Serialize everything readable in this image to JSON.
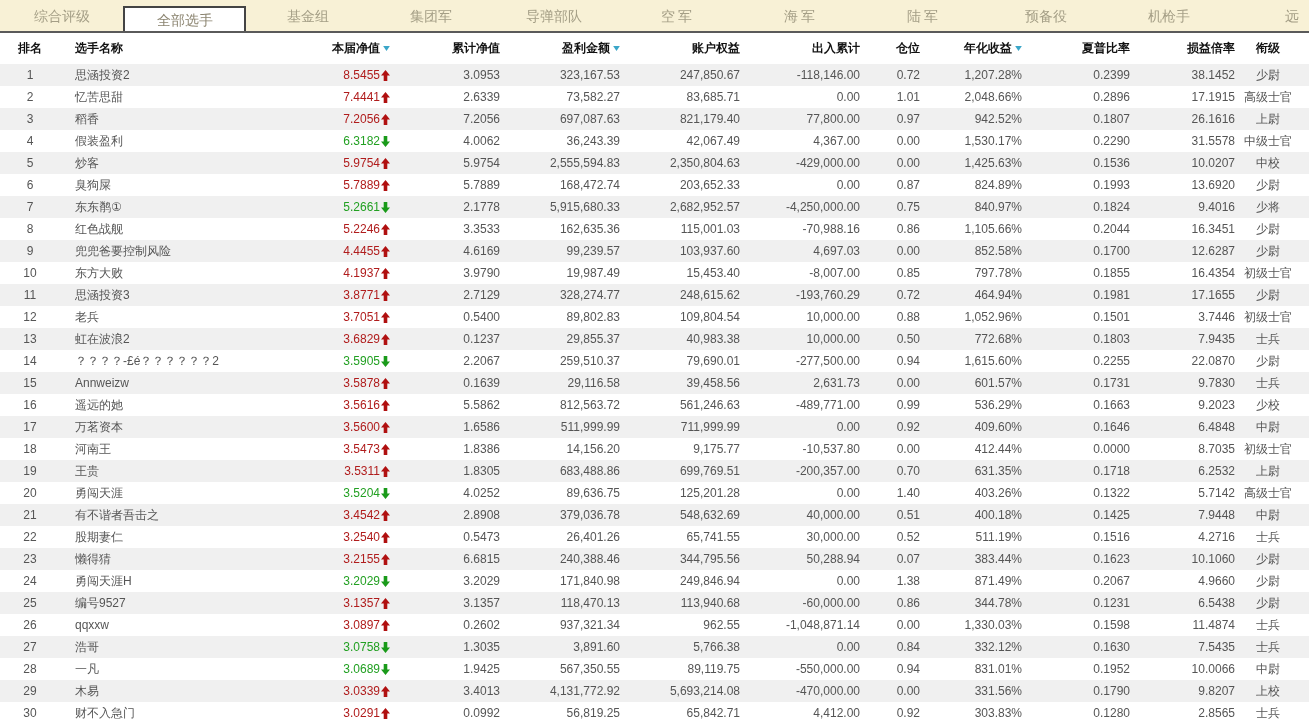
{
  "tabs": [
    {
      "label": "综合评级",
      "selected": false
    },
    {
      "label": "全部选手",
      "selected": true
    },
    {
      "label": "基金组",
      "selected": false
    },
    {
      "label": "集团军",
      "selected": false
    },
    {
      "label": "导弹部队",
      "selected": false
    },
    {
      "label": "空 军",
      "selected": false
    },
    {
      "label": "海 军",
      "selected": false
    },
    {
      "label": "陆 军",
      "selected": false
    },
    {
      "label": "预备役",
      "selected": false
    },
    {
      "label": "机枪手",
      "selected": false
    },
    {
      "label": "远",
      "selected": false
    }
  ],
  "columns": [
    {
      "label": "排名",
      "sorted": false
    },
    {
      "label": "选手名称",
      "sorted": false
    },
    {
      "label": "本届净值",
      "sorted": true
    },
    {
      "label": "累计净值",
      "sorted": false
    },
    {
      "label": "盈利金额",
      "sorted": true
    },
    {
      "label": "账户权益",
      "sorted": false
    },
    {
      "label": "出入累计",
      "sorted": false
    },
    {
      "label": "仓位",
      "sorted": false
    },
    {
      "label": "年化收益",
      "sorted": true
    },
    {
      "label": "夏普比率",
      "sorted": false
    },
    {
      "label": "损益倍率",
      "sorted": false
    },
    {
      "label": "衔级",
      "sorted": false
    }
  ],
  "rows": [
    {
      "rising": true,
      "cells": [
        "1",
        "思涵投资2",
        "8.5455",
        "3.0953",
        "323,167.53",
        "247,850.67",
        "-118,146.00",
        "0.72",
        "1,207.28%",
        "0.2399",
        "38.1452",
        "少尉"
      ]
    },
    {
      "rising": true,
      "cells": [
        "2",
        "忆苦思甜",
        "7.4441",
        "2.6339",
        "73,582.27",
        "83,685.71",
        "0.00",
        "1.01",
        "2,048.66%",
        "0.2896",
        "17.1915",
        "高级士官"
      ]
    },
    {
      "rising": true,
      "cells": [
        "3",
        "稻香",
        "7.2056",
        "7.2056",
        "697,087.63",
        "821,179.40",
        "77,800.00",
        "0.97",
        "942.52%",
        "0.1807",
        "26.1616",
        "上尉"
      ]
    },
    {
      "rising": false,
      "cells": [
        "4",
        "假装盈利",
        "6.3182",
        "4.0062",
        "36,243.39",
        "42,067.49",
        "4,367.00",
        "0.00",
        "1,530.17%",
        "0.2290",
        "31.5578",
        "中级士官"
      ]
    },
    {
      "rising": true,
      "cells": [
        "5",
        "炒客",
        "5.9754",
        "5.9754",
        "2,555,594.83",
        "2,350,804.63",
        "-429,000.00",
        "0.00",
        "1,425.63%",
        "0.1536",
        "10.0207",
        "中校"
      ]
    },
    {
      "rising": true,
      "cells": [
        "6",
        "臭狗屎",
        "5.7889",
        "5.7889",
        "168,472.74",
        "203,652.33",
        "0.00",
        "0.87",
        "824.89%",
        "0.1993",
        "13.6920",
        "少尉"
      ]
    },
    {
      "rising": false,
      "cells": [
        "7",
        "东东鹡①",
        "5.2661",
        "2.1778",
        "5,915,680.33",
        "2,682,952.57",
        "-4,250,000.00",
        "0.75",
        "840.97%",
        "0.1824",
        "9.4016",
        "少将"
      ]
    },
    {
      "rising": true,
      "cells": [
        "8",
        "红色战舰",
        "5.2246",
        "3.3533",
        "162,635.36",
        "115,001.03",
        "-70,988.16",
        "0.86",
        "1,105.66%",
        "0.2044",
        "16.3451",
        "少尉"
      ]
    },
    {
      "rising": true,
      "cells": [
        "9",
        "兜兜爸要控制风险",
        "4.4455",
        "4.6169",
        "99,239.57",
        "103,937.60",
        "4,697.03",
        "0.00",
        "852.58%",
        "0.1700",
        "12.6287",
        "少尉"
      ]
    },
    {
      "rising": true,
      "cells": [
        "10",
        "东方大败",
        "4.1937",
        "3.9790",
        "19,987.49",
        "15,453.40",
        "-8,007.00",
        "0.85",
        "797.78%",
        "0.1855",
        "16.4354",
        "初级士官"
      ]
    },
    {
      "rising": true,
      "cells": [
        "11",
        "思涵投资3",
        "3.8771",
        "2.7129",
        "328,274.77",
        "248,615.62",
        "-193,760.29",
        "0.72",
        "464.94%",
        "0.1981",
        "17.1655",
        "少尉"
      ]
    },
    {
      "rising": true,
      "cells": [
        "12",
        "老兵",
        "3.7051",
        "0.5400",
        "89,802.83",
        "109,804.54",
        "10,000.00",
        "0.88",
        "1,052.96%",
        "0.1501",
        "3.7446",
        "初级士官"
      ]
    },
    {
      "rising": true,
      "cells": [
        "13",
        "虹在波浪2",
        "3.6829",
        "0.1237",
        "29,855.37",
        "40,983.38",
        "10,000.00",
        "0.50",
        "772.68%",
        "0.1803",
        "7.9435",
        "士兵"
      ]
    },
    {
      "rising": false,
      "cells": [
        "14",
        "？？？？-£é？？？？？？2",
        "3.5905",
        "2.2067",
        "259,510.37",
        "79,690.01",
        "-277,500.00",
        "0.94",
        "1,615.60%",
        "0.2255",
        "22.0870",
        "少尉"
      ]
    },
    {
      "rising": true,
      "cells": [
        "15",
        "Annweizw",
        "3.5878",
        "0.1639",
        "29,116.58",
        "39,458.56",
        "2,631.73",
        "0.00",
        "601.57%",
        "0.1731",
        "9.7830",
        "士兵"
      ]
    },
    {
      "rising": true,
      "cells": [
        "16",
        "遥远的她",
        "3.5616",
        "5.5862",
        "812,563.72",
        "561,246.63",
        "-489,771.00",
        "0.99",
        "536.29%",
        "0.1663",
        "9.2023",
        "少校"
      ]
    },
    {
      "rising": true,
      "cells": [
        "17",
        "万茗资本",
        "3.5600",
        "1.6586",
        "511,999.99",
        "711,999.99",
        "0.00",
        "0.92",
        "409.60%",
        "0.1646",
        "6.4848",
        "中尉"
      ]
    },
    {
      "rising": true,
      "cells": [
        "18",
        "河南王",
        "3.5473",
        "1.8386",
        "14,156.20",
        "9,175.77",
        "-10,537.80",
        "0.00",
        "412.44%",
        "0.0000",
        "8.7035",
        "初级士官"
      ]
    },
    {
      "rising": true,
      "cells": [
        "19",
        "王贵",
        "3.5311",
        "1.8305",
        "683,488.86",
        "699,769.51",
        "-200,357.00",
        "0.70",
        "631.35%",
        "0.1718",
        "6.2532",
        "上尉"
      ]
    },
    {
      "rising": false,
      "cells": [
        "20",
        "勇闯天涯",
        "3.5204",
        "4.0252",
        "89,636.75",
        "125,201.28",
        "0.00",
        "1.40",
        "403.26%",
        "0.1322",
        "5.7142",
        "高级士官"
      ]
    },
    {
      "rising": true,
      "cells": [
        "21",
        "有不谐者吾击之",
        "3.4542",
        "2.8908",
        "379,036.78",
        "548,632.69",
        "40,000.00",
        "0.51",
        "400.18%",
        "0.1425",
        "7.9448",
        "中尉"
      ]
    },
    {
      "rising": true,
      "cells": [
        "22",
        "股期妻仁",
        "3.2540",
        "0.5473",
        "26,401.26",
        "65,741.55",
        "30,000.00",
        "0.52",
        "511.19%",
        "0.1516",
        "4.2716",
        "士兵"
      ]
    },
    {
      "rising": true,
      "cells": [
        "23",
        "懒得猜",
        "3.2155",
        "6.6815",
        "240,388.46",
        "344,795.56",
        "50,288.94",
        "0.07",
        "383.44%",
        "0.1623",
        "10.1060",
        "少尉"
      ]
    },
    {
      "rising": false,
      "cells": [
        "24",
        "勇闯天涯H",
        "3.2029",
        "3.2029",
        "171,840.98",
        "249,846.94",
        "0.00",
        "1.38",
        "871.49%",
        "0.2067",
        "4.9660",
        "少尉"
      ]
    },
    {
      "rising": true,
      "cells": [
        "25",
        "编号9527",
        "3.1357",
        "3.1357",
        "118,470.13",
        "113,940.68",
        "-60,000.00",
        "0.86",
        "344.78%",
        "0.1231",
        "6.5438",
        "少尉"
      ]
    },
    {
      "rising": true,
      "cells": [
        "26",
        "qqxxw",
        "3.0897",
        "0.2602",
        "937,321.34",
        "962.55",
        "-1,048,871.14",
        "0.00",
        "1,330.03%",
        "0.1598",
        "11.4874",
        "士兵"
      ]
    },
    {
      "rising": false,
      "cells": [
        "27",
        "浩哥",
        "3.0758",
        "1.3035",
        "3,891.60",
        "5,766.38",
        "0.00",
        "0.84",
        "332.12%",
        "0.1630",
        "7.5435",
        "士兵"
      ]
    },
    {
      "rising": false,
      "cells": [
        "28",
        "一凡",
        "3.0689",
        "1.9425",
        "567,350.55",
        "89,119.75",
        "-550,000.00",
        "0.94",
        "831.01%",
        "0.1952",
        "10.0066",
        "中尉"
      ]
    },
    {
      "rising": true,
      "cells": [
        "29",
        "木易",
        "3.0339",
        "3.4013",
        "4,131,772.92",
        "5,693,214.08",
        "-470,000.00",
        "0.00",
        "331.56%",
        "0.1790",
        "9.8207",
        "上校"
      ]
    },
    {
      "rising": true,
      "cells": [
        "30",
        "财不入急门",
        "3.0291",
        "0.0992",
        "56,819.25",
        "65,842.71",
        "4,412.00",
        "0.92",
        "303.83%",
        "0.1280",
        "2.8565",
        "士兵"
      ]
    }
  ]
}
